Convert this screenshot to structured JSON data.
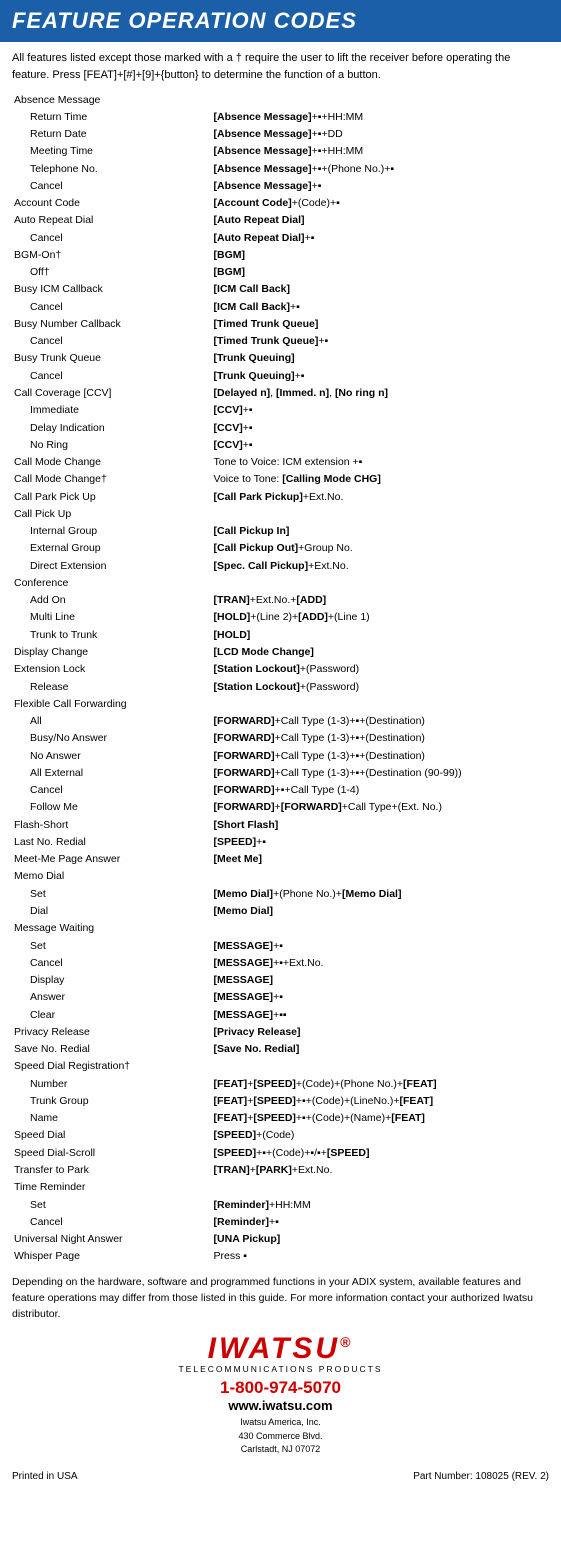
{
  "header": {
    "title": "FEATURE OPERATION CODES",
    "bg_color": "#1a5fa8",
    "text_color": "#ffffff"
  },
  "intro": "All features listed except those marked with a † require the user to lift the receiver before operating the feature. Press [FEAT]+[#]+[9]+{button} to determine the function of a button.",
  "features": [
    {
      "level": 0,
      "name": "Absence Message",
      "code": ""
    },
    {
      "level": 1,
      "name": "Return Time",
      "code": "[Absence Message]+▪+HH:MM"
    },
    {
      "level": 1,
      "name": "Return Date",
      "code": "[Absence Message]+▪+DD"
    },
    {
      "level": 1,
      "name": "Meeting Time",
      "code": "[Absence Message]+▪+HH:MM"
    },
    {
      "level": 1,
      "name": "Telephone No.",
      "code": "[Absence Message]+▪+(Phone No.)+▪"
    },
    {
      "level": 1,
      "name": "Cancel",
      "code": "[Absence Message]+▪"
    },
    {
      "level": 0,
      "name": "Account Code",
      "code": "[Account Code]+(Code)+▪"
    },
    {
      "level": 0,
      "name": "Auto Repeat Dial",
      "code": "[Auto Repeat Dial]"
    },
    {
      "level": 1,
      "name": "Cancel",
      "code": "[Auto Repeat Dial]+▪"
    },
    {
      "level": 0,
      "name": "BGM-On†",
      "code": "[BGM]"
    },
    {
      "level": 1,
      "name": "Off†",
      "code": "[BGM]"
    },
    {
      "level": 0,
      "name": "Busy ICM Callback",
      "code": "[ICM Call Back]"
    },
    {
      "level": 1,
      "name": "Cancel",
      "code": "[ICM Call Back]+▪"
    },
    {
      "level": 0,
      "name": "Busy Number Callback",
      "code": "[Timed Trunk Queue]"
    },
    {
      "level": 1,
      "name": "Cancel",
      "code": "[Timed Trunk Queue]+▪"
    },
    {
      "level": 0,
      "name": "Busy Trunk Queue",
      "code": "[Trunk Queuing]"
    },
    {
      "level": 1,
      "name": "Cancel",
      "code": "[Trunk Queuing]+▪"
    },
    {
      "level": 0,
      "name": "Call Coverage [CCV]",
      "code": "[Delayed n],  [Immed. n],  [No ring n]"
    },
    {
      "level": 1,
      "name": "Immediate",
      "code": "[CCV]+▪"
    },
    {
      "level": 1,
      "name": "Delay Indication",
      "code": "[CCV]+▪"
    },
    {
      "level": 1,
      "name": "No Ring",
      "code": "[CCV]+▪"
    },
    {
      "level": 0,
      "name": "Call Mode Change",
      "code": "Tone to Voice: ICM extension +▪"
    },
    {
      "level": 0,
      "name": "Call Mode Change†",
      "code": "Voice to Tone: [Calling Mode CHG]"
    },
    {
      "level": 0,
      "name": "Call Park Pick Up",
      "code": "[Call Park Pickup]+Ext.No."
    },
    {
      "level": 0,
      "name": "Call Pick Up",
      "code": ""
    },
    {
      "level": 1,
      "name": "Internal Group",
      "code": "[Call Pickup In]"
    },
    {
      "level": 1,
      "name": "External Group",
      "code": "[Call Pickup Out]+Group No."
    },
    {
      "level": 1,
      "name": "Direct Extension",
      "code": "[Spec. Call Pickup]+Ext.No."
    },
    {
      "level": 0,
      "name": "Conference",
      "code": ""
    },
    {
      "level": 1,
      "name": "Add On",
      "code": "[TRAN]+Ext.No.+[ADD]"
    },
    {
      "level": 1,
      "name": "Multi Line",
      "code": "[HOLD]+(Line 2)+[ADD]+(Line 1)"
    },
    {
      "level": 1,
      "name": "Trunk to Trunk",
      "code": "[HOLD]"
    },
    {
      "level": 0,
      "name": "Display Change",
      "code": "[LCD Mode Change]"
    },
    {
      "level": 0,
      "name": "Extension Lock",
      "code": "[Station Lockout]+(Password)"
    },
    {
      "level": 1,
      "name": "Release",
      "code": "[Station Lockout]+(Password)"
    },
    {
      "level": 0,
      "name": "Flexible Call Forwarding",
      "code": ""
    },
    {
      "level": 1,
      "name": "All",
      "code": "[FORWARD]+Call Type (1-3)+▪+(Destination)"
    },
    {
      "level": 1,
      "name": "Busy/No Answer",
      "code": "[FORWARD]+Call Type (1-3)+▪+(Destination)"
    },
    {
      "level": 1,
      "name": "No Answer",
      "code": "[FORWARD]+Call Type (1-3)+▪+(Destination)"
    },
    {
      "level": 1,
      "name": "All External",
      "code": "[FORWARD]+Call Type (1-3)+▪+(Destination (90-99))"
    },
    {
      "level": 1,
      "name": "Cancel",
      "code": "[FORWARD]+▪+Call Type (1-4)"
    },
    {
      "level": 1,
      "name": "Follow Me",
      "code": "[FORWARD]+[FORWARD]+Call Type+(Ext. No.)"
    },
    {
      "level": 0,
      "name": "Flash-Short",
      "code": "[Short Flash]"
    },
    {
      "level": 0,
      "name": "Last No. Redial",
      "code": "[SPEED]+▪"
    },
    {
      "level": 0,
      "name": "Meet-Me Page Answer",
      "code": "[Meet Me]"
    },
    {
      "level": 0,
      "name": "Memo Dial",
      "code": ""
    },
    {
      "level": 1,
      "name": "Set",
      "code": "[Memo Dial]+(Phone No.)+[Memo Dial]"
    },
    {
      "level": 1,
      "name": "Dial",
      "code": "[Memo Dial]"
    },
    {
      "level": 0,
      "name": "Message Waiting",
      "code": ""
    },
    {
      "level": 1,
      "name": "Set",
      "code": "[MESSAGE]+▪"
    },
    {
      "level": 1,
      "name": "Cancel",
      "code": "[MESSAGE]+▪+Ext.No."
    },
    {
      "level": 1,
      "name": "Display",
      "code": "[MESSAGE]"
    },
    {
      "level": 1,
      "name": "Answer",
      "code": "[MESSAGE]+▪"
    },
    {
      "level": 1,
      "name": "Clear",
      "code": "[MESSAGE]+▪▪"
    },
    {
      "level": 0,
      "name": "Privacy Release",
      "code": "[Privacy Release]"
    },
    {
      "level": 0,
      "name": "Save No. Redial",
      "code": "[Save No. Redial]"
    },
    {
      "level": 0,
      "name": "Speed Dial Registration†",
      "code": ""
    },
    {
      "level": 1,
      "name": "Number",
      "code": "[FEAT]+[SPEED]+(Code)+(Phone No.)+[FEAT]"
    },
    {
      "level": 1,
      "name": "Trunk Group",
      "code": "[FEAT]+[SPEED]+▪+(Code)+(LineNo.)+[FEAT]"
    },
    {
      "level": 1,
      "name": "Name",
      "code": "[FEAT]+[SPEED]+▪+(Code)+(Name)+[FEAT]"
    },
    {
      "level": 0,
      "name": "Speed Dial",
      "code": "[SPEED]+(Code)"
    },
    {
      "level": 0,
      "name": "Speed Dial-Scroll",
      "code": "[SPEED]+▪+(Code)+▪/▪+[SPEED]"
    },
    {
      "level": 0,
      "name": "Transfer to Park",
      "code": "[TRAN]+[PARK]+Ext.No."
    },
    {
      "level": 0,
      "name": "Time Reminder",
      "code": ""
    },
    {
      "level": 1,
      "name": "Set",
      "code": "[Reminder]+HH:MM"
    },
    {
      "level": 1,
      "name": "Cancel",
      "code": "[Reminder]+▪"
    },
    {
      "level": 0,
      "name": "Universal Night Answer",
      "code": "[UNA Pickup]"
    },
    {
      "level": 0,
      "name": "Whisper Page",
      "code": "Press ▪"
    }
  ],
  "footer_note": "Depending on the hardware, software and programmed functions in your ADIX system, available features and feature operations may differ from those listed in this guide. For more information contact your authorized Iwatsu distributor.",
  "brand": {
    "name": "IWATSU",
    "registered": "®",
    "tagline": "TELECOMMUNICATIONS PRODUCTS",
    "phone": "1-800-974-5070",
    "website": "www.iwatsu.com",
    "company": "Iwatsu America, Inc.",
    "address1": "430 Commerce Blvd.",
    "address2": "Carlstadt, NJ  07072"
  },
  "page_footer": {
    "left": "Printed in USA",
    "right": "Part Number:  108025 (REV. 2)"
  }
}
